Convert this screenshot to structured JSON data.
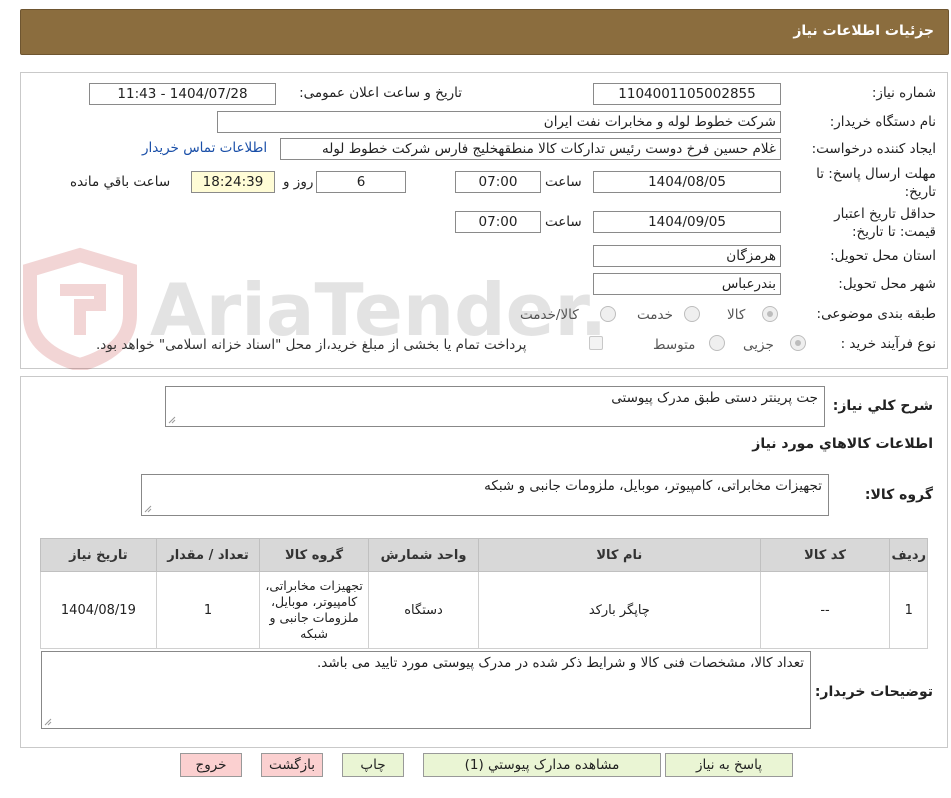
{
  "header": {
    "title": "جزئیات اطلاعات نیاز"
  },
  "fields": {
    "need_number_label": "شماره نیاز:",
    "need_number": "1104001105002855",
    "announce_label": "تاریخ و ساعت اعلان عمومی:",
    "announce_value": "1404/07/28 - 11:43",
    "buyer_org_label": "نام دستگاه خریدار:",
    "buyer_org": "شرکت خطوط لوله و مخابرات نفت ایران",
    "requester_label": "ایجاد کننده درخواست:",
    "requester": "غلام حسین فرخ دوست رئیس تدارکات کالا منطقهخلیج فارس شرکت خطوط لوله",
    "contact_link": "اطلاعات تماس خریدار",
    "deadline_label_1": "مهلت ارسال پاسخ: تا",
    "deadline_label_2": "تاریخ:",
    "deadline_date": "1404/08/05",
    "time_label": "ساعت",
    "deadline_time": "07:00",
    "days_value": "6",
    "days_label": "روز و",
    "remaining_time": "18:24:39",
    "remaining_label": "ساعت باقي مانده",
    "validity_label_1": "حداقل تاريخ اعتبار",
    "validity_label_2": "قیمت: تا تاریخ:",
    "validity_date": "1404/09/05",
    "validity_time": "07:00",
    "province_label": "استان محل تحویل:",
    "province": "هرمزگان",
    "city_label": "شهر محل تحویل:",
    "city": "بندرعباس",
    "category_label": "طبقه بندی موضوعی:",
    "category_options": [
      "کالا",
      "خدمت",
      "کالا/خدمت"
    ],
    "process_label": "نوع فرآیند خرید :",
    "process_options": [
      "جزیی",
      "متوسط"
    ],
    "process_note": "پرداخت تمام یا بخشی از مبلغ خرید،از محل \"اسناد خزانه اسلامی\" خواهد بود."
  },
  "summary": {
    "label": "شرح کلي نياز:",
    "value": "جت پرینتر دستی طبق مدرک پیوستی"
  },
  "goods_section": {
    "title": "اطلاعات کالاهاي مورد نياز",
    "group_label": "گروه کالا:",
    "group_value": "تجهیزات مخابراتی، کامپیوتر، موبایل، ملزومات جانبی و شبکه"
  },
  "table": {
    "headers": [
      "رديف",
      "کد کالا",
      "نام کالا",
      "واحد شمارش",
      "گروه کالا",
      "تعداد / مقدار",
      "تاریخ نیاز"
    ],
    "rows": [
      {
        "row": "1",
        "code": "--",
        "name": "چاپگر بارکد",
        "unit": "دستگاه",
        "group": "تجهیزات مخابراتی، کامپیوتر، موبایل، ملزومات جانبی و شبکه",
        "qty": "1",
        "date": "1404/08/19"
      }
    ]
  },
  "buyer_notes": {
    "label": "توضیحات خریدار:",
    "value": "تعداد کالا، مشخصات فنی کالا و شرایط ذکر شده در مدرک پیوستی مورد تایید می باشد."
  },
  "buttons": {
    "reply": "پاسخ به نیاز",
    "attachments": "مشاهده مدارک پیوستي (1)",
    "print": "چاپ",
    "back": "بازگشت",
    "exit": "خروج"
  },
  "watermark": "AriaTender.neT",
  "colors": {
    "header_bg": "#8b6d3e",
    "button_green": "#eaf5d4",
    "button_red": "#fbd0d0",
    "remaining_bg": "#fffcd6"
  }
}
